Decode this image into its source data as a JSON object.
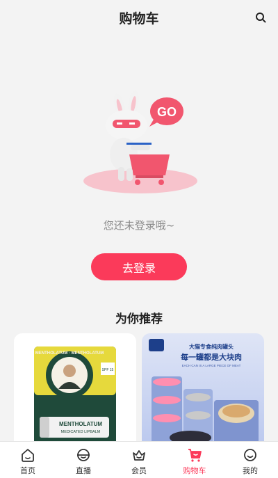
{
  "header": {
    "title": "购物车"
  },
  "empty": {
    "message": "您还未登录哦~",
    "go_badge": "GO"
  },
  "login_button": "去登录",
  "recommend": {
    "title": "为你推荐",
    "items": [
      {
        "brand_ring": "MENTHOLATUM · MENTHOLATUM",
        "name": "MENTHOLATUM",
        "subtitle": "MEDICATED LIPBALM",
        "spf": "SPF 15"
      },
      {
        "headline1": "大猫专食纯肉罐头",
        "headline2": "每一罐都是大块肉",
        "tagline": "EACH CAN IS A LARGE PIECE OF MEAT"
      }
    ]
  },
  "tabbar": {
    "items": [
      {
        "label": "首页",
        "icon": "home-icon"
      },
      {
        "label": "直播",
        "icon": "live-icon"
      },
      {
        "label": "会员",
        "icon": "member-icon"
      },
      {
        "label": "购物车",
        "icon": "cart-icon",
        "active": true
      },
      {
        "label": "我的",
        "icon": "profile-icon"
      }
    ],
    "accent": "#fb3a5a"
  },
  "colors": {
    "accent": "#fb3a5a",
    "background": "#f3f3f3"
  }
}
